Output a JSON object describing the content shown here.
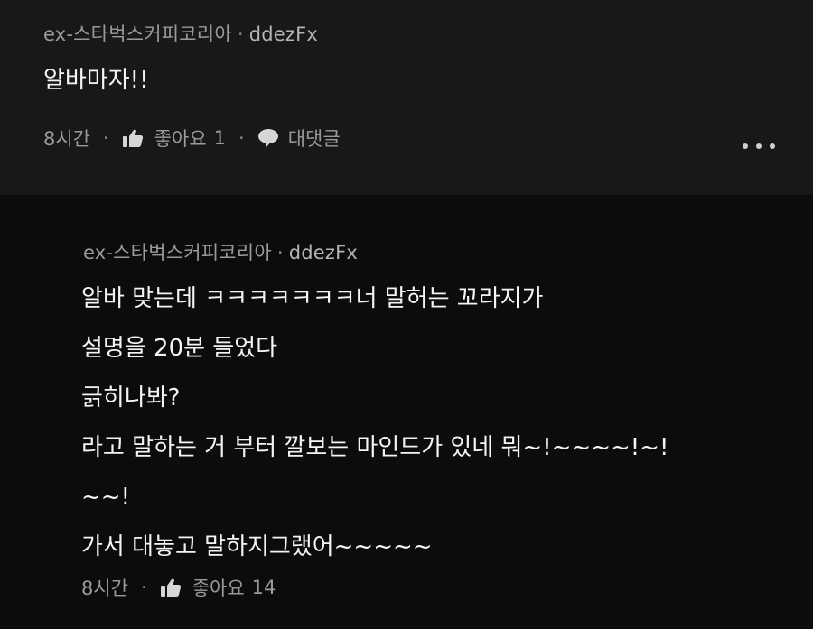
{
  "comment": {
    "author": "ex-스타벅스커피코리아",
    "separator": "·",
    "nickname": "ddezFx",
    "text": "알바마자!!",
    "time": "8시간",
    "like_label": "좋아요",
    "like_count": "1",
    "reply_label": "대댓글",
    "more_icon": "more-dots-icon"
  },
  "reply": {
    "author": "ex-스타벅스커피코리아",
    "separator": "·",
    "nickname": "ddezFx",
    "lines": [
      "알바 맞는데 ㅋㅋㅋㅋㅋㅋㅋ너 말허는 꼬라지가",
      "설명을 20분 들었다",
      "긁히나봐?",
      "라고 말하는 거 부터 깔보는 마인드가 있네 뭐~!~~~~!~!",
      "~~!",
      "가서 대놓고 말하지그랬어~~~~~"
    ],
    "time": "8시간",
    "like_label": "좋아요",
    "like_count": "14"
  },
  "icons": {
    "like": "thumbs-up-icon",
    "reply": "speech-bubble-icon"
  },
  "colors": {
    "top_background": "#181818",
    "reply_background": "#0c0c0c",
    "meta_text": "#9a9a9a",
    "body_text": "#f4f4f4"
  }
}
